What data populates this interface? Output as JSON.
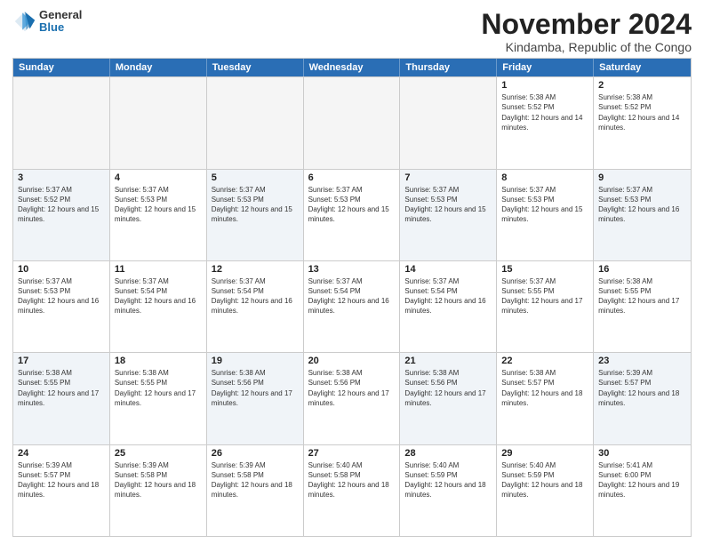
{
  "logo": {
    "general": "General",
    "blue": "Blue"
  },
  "title": "November 2024",
  "location": "Kindamba, Republic of the Congo",
  "weekdays": [
    "Sunday",
    "Monday",
    "Tuesday",
    "Wednesday",
    "Thursday",
    "Friday",
    "Saturday"
  ],
  "rows": [
    [
      {
        "day": "",
        "empty": true
      },
      {
        "day": "",
        "empty": true
      },
      {
        "day": "",
        "empty": true
      },
      {
        "day": "",
        "empty": true
      },
      {
        "day": "",
        "empty": true
      },
      {
        "day": "1",
        "sunrise": "5:38 AM",
        "sunset": "5:52 PM",
        "daylight": "12 hours and 14 minutes."
      },
      {
        "day": "2",
        "sunrise": "5:38 AM",
        "sunset": "5:52 PM",
        "daylight": "12 hours and 14 minutes."
      }
    ],
    [
      {
        "day": "3",
        "sunrise": "5:37 AM",
        "sunset": "5:52 PM",
        "daylight": "12 hours and 15 minutes."
      },
      {
        "day": "4",
        "sunrise": "5:37 AM",
        "sunset": "5:53 PM",
        "daylight": "12 hours and 15 minutes."
      },
      {
        "day": "5",
        "sunrise": "5:37 AM",
        "sunset": "5:53 PM",
        "daylight": "12 hours and 15 minutes."
      },
      {
        "day": "6",
        "sunrise": "5:37 AM",
        "sunset": "5:53 PM",
        "daylight": "12 hours and 15 minutes."
      },
      {
        "day": "7",
        "sunrise": "5:37 AM",
        "sunset": "5:53 PM",
        "daylight": "12 hours and 15 minutes."
      },
      {
        "day": "8",
        "sunrise": "5:37 AM",
        "sunset": "5:53 PM",
        "daylight": "12 hours and 15 minutes."
      },
      {
        "day": "9",
        "sunrise": "5:37 AM",
        "sunset": "5:53 PM",
        "daylight": "12 hours and 16 minutes."
      }
    ],
    [
      {
        "day": "10",
        "sunrise": "5:37 AM",
        "sunset": "5:53 PM",
        "daylight": "12 hours and 16 minutes."
      },
      {
        "day": "11",
        "sunrise": "5:37 AM",
        "sunset": "5:54 PM",
        "daylight": "12 hours and 16 minutes."
      },
      {
        "day": "12",
        "sunrise": "5:37 AM",
        "sunset": "5:54 PM",
        "daylight": "12 hours and 16 minutes."
      },
      {
        "day": "13",
        "sunrise": "5:37 AM",
        "sunset": "5:54 PM",
        "daylight": "12 hours and 16 minutes."
      },
      {
        "day": "14",
        "sunrise": "5:37 AM",
        "sunset": "5:54 PM",
        "daylight": "12 hours and 16 minutes."
      },
      {
        "day": "15",
        "sunrise": "5:37 AM",
        "sunset": "5:55 PM",
        "daylight": "12 hours and 17 minutes."
      },
      {
        "day": "16",
        "sunrise": "5:38 AM",
        "sunset": "5:55 PM",
        "daylight": "12 hours and 17 minutes."
      }
    ],
    [
      {
        "day": "17",
        "sunrise": "5:38 AM",
        "sunset": "5:55 PM",
        "daylight": "12 hours and 17 minutes."
      },
      {
        "day": "18",
        "sunrise": "5:38 AM",
        "sunset": "5:55 PM",
        "daylight": "12 hours and 17 minutes."
      },
      {
        "day": "19",
        "sunrise": "5:38 AM",
        "sunset": "5:56 PM",
        "daylight": "12 hours and 17 minutes."
      },
      {
        "day": "20",
        "sunrise": "5:38 AM",
        "sunset": "5:56 PM",
        "daylight": "12 hours and 17 minutes."
      },
      {
        "day": "21",
        "sunrise": "5:38 AM",
        "sunset": "5:56 PM",
        "daylight": "12 hours and 17 minutes."
      },
      {
        "day": "22",
        "sunrise": "5:38 AM",
        "sunset": "5:57 PM",
        "daylight": "12 hours and 18 minutes."
      },
      {
        "day": "23",
        "sunrise": "5:39 AM",
        "sunset": "5:57 PM",
        "daylight": "12 hours and 18 minutes."
      }
    ],
    [
      {
        "day": "24",
        "sunrise": "5:39 AM",
        "sunset": "5:57 PM",
        "daylight": "12 hours and 18 minutes."
      },
      {
        "day": "25",
        "sunrise": "5:39 AM",
        "sunset": "5:58 PM",
        "daylight": "12 hours and 18 minutes."
      },
      {
        "day": "26",
        "sunrise": "5:39 AM",
        "sunset": "5:58 PM",
        "daylight": "12 hours and 18 minutes."
      },
      {
        "day": "27",
        "sunrise": "5:40 AM",
        "sunset": "5:58 PM",
        "daylight": "12 hours and 18 minutes."
      },
      {
        "day": "28",
        "sunrise": "5:40 AM",
        "sunset": "5:59 PM",
        "daylight": "12 hours and 18 minutes."
      },
      {
        "day": "29",
        "sunrise": "5:40 AM",
        "sunset": "5:59 PM",
        "daylight": "12 hours and 18 minutes."
      },
      {
        "day": "30",
        "sunrise": "5:41 AM",
        "sunset": "6:00 PM",
        "daylight": "12 hours and 19 minutes."
      }
    ]
  ]
}
